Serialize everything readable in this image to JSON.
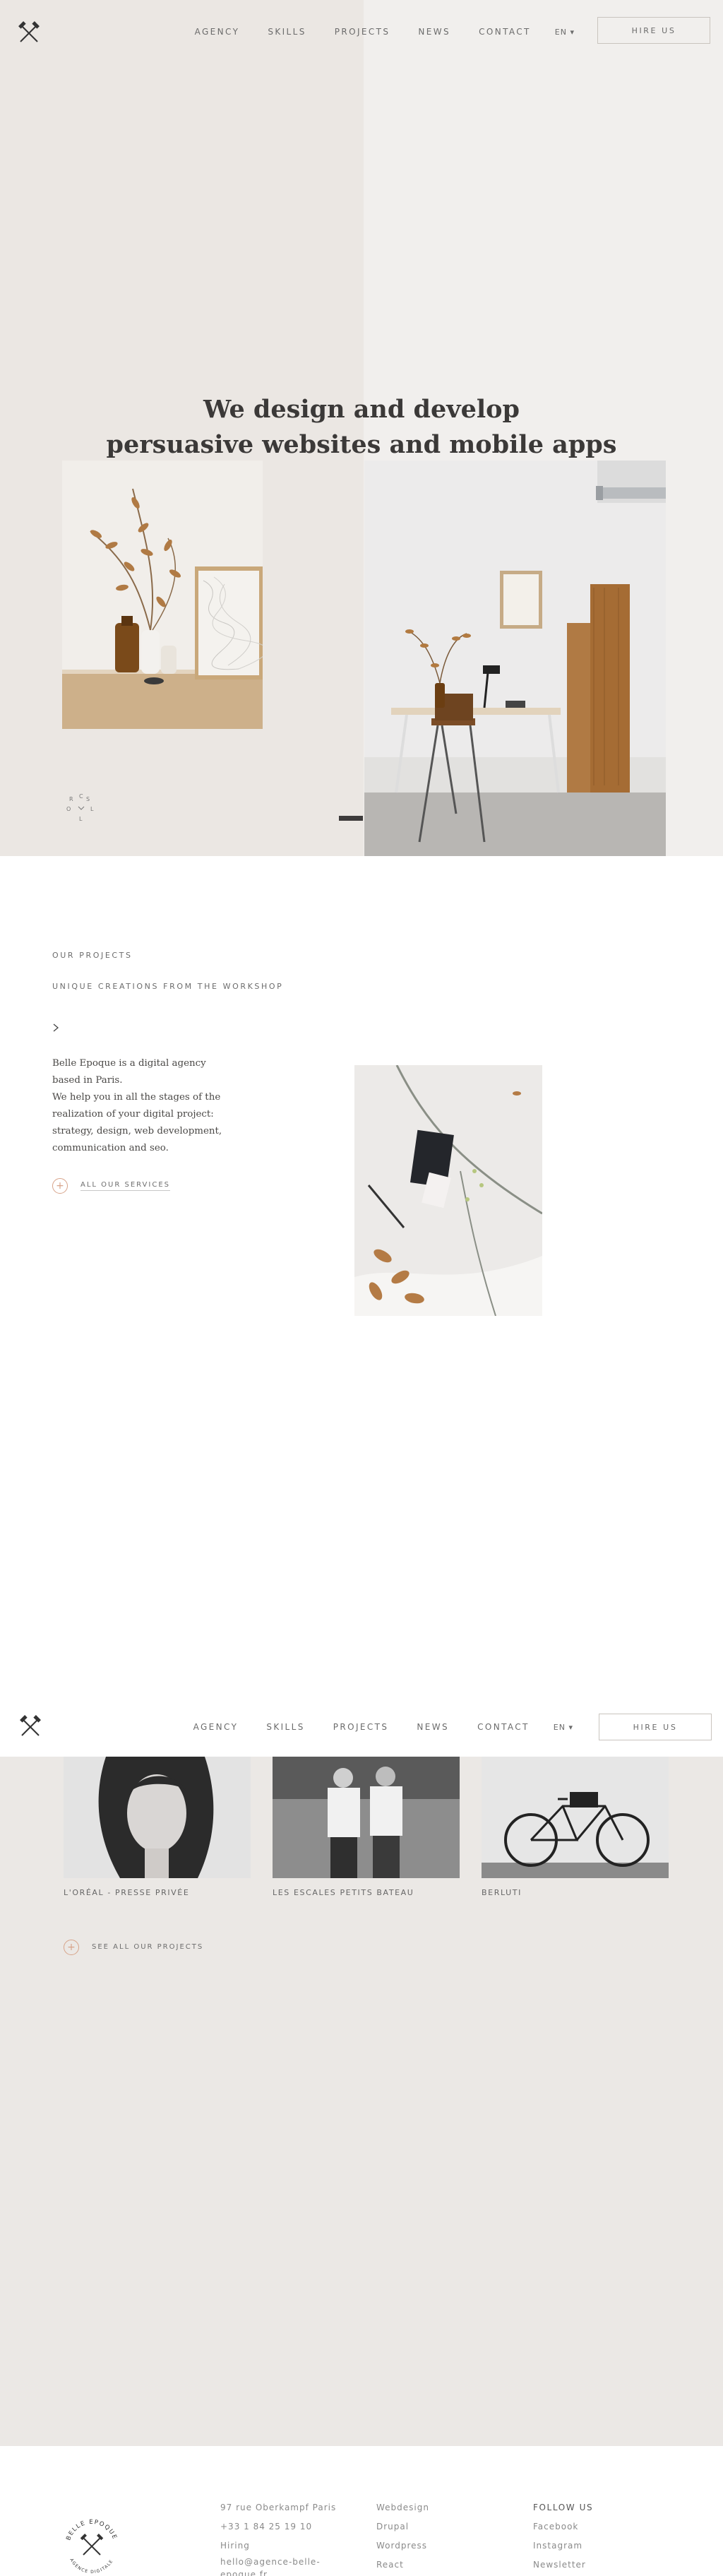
{
  "header": {
    "nav": [
      "AGENCY",
      "SKILLS",
      "PROJECTS",
      "NEWS",
      "CONTACT"
    ],
    "lang": "EN ▾",
    "hire_label": "HIRE US"
  },
  "hero": {
    "title_line1": "We design and develop",
    "title_line2": "persuasive websites and mobile apps",
    "scroll_letters": [
      "S",
      "C",
      "R",
      "O",
      "L",
      "L"
    ]
  },
  "projects_intro": {
    "eyebrow": "OUR PROJECTS",
    "subtitle": "UNIQUE CREATIONS FROM THE WORKSHOP",
    "paragraph1": "Belle Epoque is a digital agency based in Paris.",
    "paragraph2": "We help you in all the stages of the realization of your digital project: strategy, design, web development, communication and seo.",
    "services_link": "ALL OUR SERVICES"
  },
  "portfolio": {
    "items": [
      {
        "label": "L'ORÉAL - PRESSE PRIVÉE"
      },
      {
        "label": "LES ESCALES PETITS BATEAU"
      },
      {
        "label": "BERLUTI"
      }
    ],
    "see_all": "SEE ALL OUR PROJECTS"
  },
  "footer": {
    "badge_text": "BELLE EPOQUE",
    "badge_sub": "AGENCE DIGITALE",
    "contact": [
      "97 rue Oberkampf Paris",
      "+33 1 84 25 19 10",
      "Hiring",
      "hello@agence-belle-",
      "epoque.fr"
    ],
    "skills": [
      "Webdesign",
      "Drupal",
      "Wordpress",
      "React"
    ],
    "follow_title": "FOLLOW US",
    "follow": [
      "Facebook",
      "Instagram",
      "Newsletter"
    ]
  },
  "colors": {
    "accent": "#d7a389",
    "text": "#3b3938",
    "hero_bg": "#f1efed",
    "portfolio_bg": "#ebe8e5"
  }
}
